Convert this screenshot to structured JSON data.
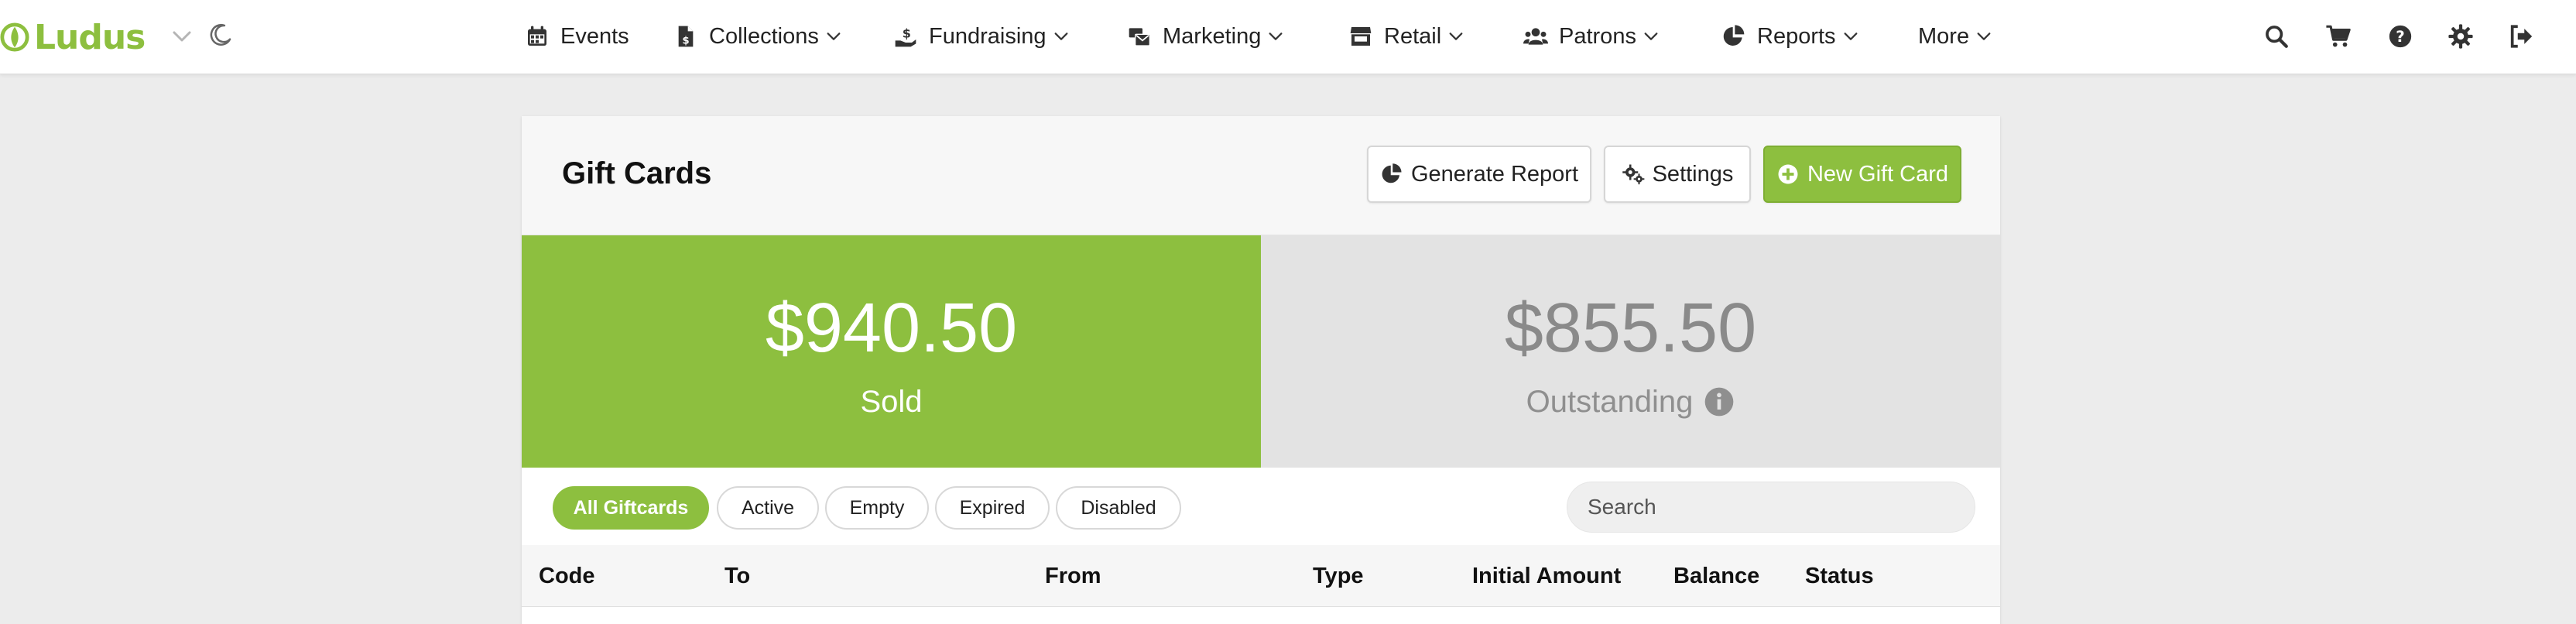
{
  "app": {
    "name": "Ludus",
    "brand_color": "#8dbf3f"
  },
  "nav": {
    "items": [
      {
        "label": "Events",
        "icon": "calendar-icon",
        "has_dropdown": false
      },
      {
        "label": "Collections",
        "icon": "document-dollar-icon",
        "has_dropdown": true
      },
      {
        "label": "Fundraising",
        "icon": "hand-dollar-icon",
        "has_dropdown": true
      },
      {
        "label": "Marketing",
        "icon": "mail-bulk-icon",
        "has_dropdown": true
      },
      {
        "label": "Retail",
        "icon": "store-icon",
        "has_dropdown": true
      },
      {
        "label": "Patrons",
        "icon": "users-icon",
        "has_dropdown": true
      },
      {
        "label": "Reports",
        "icon": "pie-chart-icon",
        "has_dropdown": true
      },
      {
        "label": "More",
        "icon": "",
        "has_dropdown": true
      }
    ],
    "right_icons": [
      "search-icon",
      "cart-icon",
      "help-icon",
      "gear-icon",
      "logout-icon"
    ]
  },
  "page": {
    "title": "Gift Cards",
    "buttons": {
      "generate_report": "Generate Report",
      "settings": "Settings",
      "new_gift_card": "New Gift Card"
    }
  },
  "stats": {
    "sold": {
      "value": "$940.50",
      "label": "Sold",
      "color": "#8dbf3f"
    },
    "outstanding": {
      "value": "$855.50",
      "label": "Outstanding",
      "color": "#e3e3e3"
    }
  },
  "filters": {
    "pills": [
      "All Giftcards",
      "Active",
      "Empty",
      "Expired",
      "Disabled"
    ],
    "selected": "All Giftcards",
    "search_placeholder": "Search"
  },
  "table": {
    "columns": [
      "Code",
      "To",
      "From",
      "Type",
      "Initial Amount",
      "Balance",
      "Status"
    ]
  }
}
